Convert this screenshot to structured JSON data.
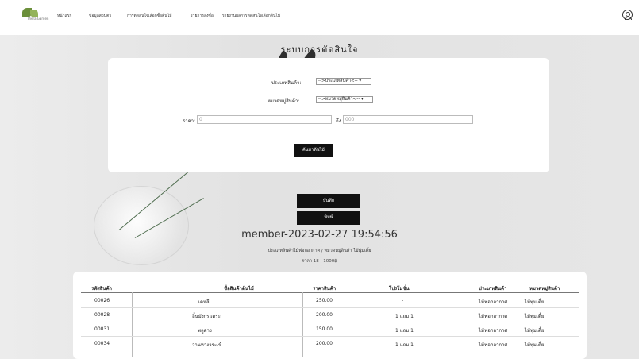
{
  "nav": {
    "brand": "Thera Garden",
    "items": [
      "หน้าแรก",
      "ข้อมูลส่วนตัว",
      "การตัดสินใจเลือกซื้อต้นไม้",
      "รายการสั่งซื้อ",
      "รายงานผลการตัดสินใจเลือกต้นไม้"
    ]
  },
  "page": {
    "title": "ระบบการตัดสินใจ"
  },
  "filters": {
    "product_type_label": "ประเภทสินค้า:",
    "product_type_value": "-->ประเภทสินค้า<--",
    "category_label": "หมวดหมู่สินค้า:",
    "category_value": "-->หมวดหมู่สินค้า<--",
    "price_label": "ราคา:",
    "price_min_placeholder": "0",
    "to_label": "ถึง",
    "price_max_placeholder": "000",
    "search_button": "ค้นหาต้นไม้"
  },
  "actions": {
    "save_button": "บันทึก",
    "print_button": "พิมพ์"
  },
  "result": {
    "member": "member-2023-02-27 19:54:56",
    "criteria": "ประเภทสินค้าไม้ฟอกอากาศ / หมวดหมู่สินค้า ไม้พุ่มเตี้ย",
    "price_range": "ราคา 18 - 1000฿"
  },
  "table": {
    "headers": [
      "รหัสสินค้า",
      "ชื่อสินค้าต้นไม้",
      "ราคาสินค้า",
      "โปรโมชั่น",
      "ประเภทสินค้า",
      "หมวดหมู่สินค้า"
    ],
    "rows": [
      [
        "00026",
        "เดหลี",
        "250.00",
        "-",
        "ไม้ฟอกอากาศ",
        "ไม้พุ่มเตี้ย"
      ],
      [
        "00028",
        "ลิ้นมังกรแคระ",
        "200.00",
        "1 แถม 1",
        "ไม้ฟอกอากาศ",
        "ไม้พุ่มเตี้ย"
      ],
      [
        "00031",
        "พลูด่าง",
        "150.00",
        "1 แถม 1",
        "ไม้ฟอกอากาศ",
        "ไม้พุ่มเตี้ย"
      ],
      [
        "00034",
        "ว่านหางจระเข้",
        "200.00",
        "1 แถม 1",
        "ไม้ฟอกอากาศ",
        "ไม้พุ่มเตี้ย"
      ]
    ]
  },
  "icons": {
    "logo": "plant-logo-icon",
    "user": "user-circle-icon"
  }
}
